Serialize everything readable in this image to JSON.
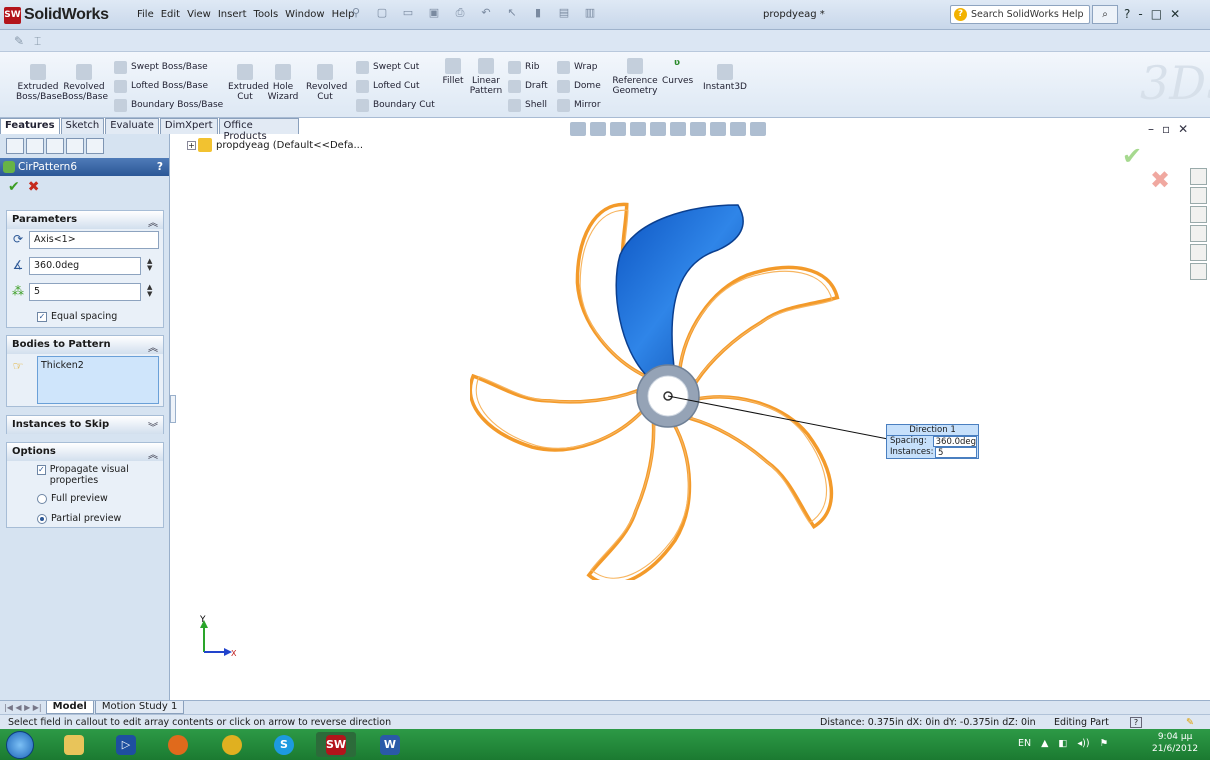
{
  "app": {
    "name": "SolidWorks",
    "document_title": "propdyeag *",
    "menu": [
      "File",
      "Edit",
      "View",
      "Insert",
      "Tools",
      "Window",
      "Help"
    ],
    "search_placeholder": "Search SolidWorks Help",
    "window_controls": [
      "?",
      "-",
      "□",
      "✕"
    ]
  },
  "command_manager": {
    "big_tools": [
      {
        "label": "Extruded Boss/Base"
      },
      {
        "label": "Revolved Boss/Base"
      },
      {
        "label": "Extruded Cut"
      },
      {
        "label": "Hole Wizard"
      },
      {
        "label": "Revolved Cut"
      },
      {
        "label": "Fillet"
      },
      {
        "label": "Linear Pattern"
      },
      {
        "label": "Reference Geometry"
      },
      {
        "label": "Curves"
      },
      {
        "label": "Instant3D"
      }
    ],
    "small_tools": {
      "swept_boss": "Swept Boss/Base",
      "lofted_boss": "Lofted Boss/Base",
      "boundary_boss": "Boundary Boss/Base",
      "swept_cut": "Swept Cut",
      "lofted_cut": "Lofted Cut",
      "boundary_cut": "Boundary Cut",
      "rib": "Rib",
      "draft": "Draft",
      "shell": "Shell",
      "wrap": "Wrap",
      "dome": "Dome",
      "mirror": "Mirror"
    }
  },
  "tabs": [
    "Features",
    "Sketch",
    "Evaluate",
    "DimXpert",
    "Office Products"
  ],
  "property_manager": {
    "title": "CirPattern6",
    "help": "?",
    "parameters": {
      "title": "Parameters",
      "axis": "Axis<1>",
      "angle": "360.0deg",
      "instances": "5",
      "equal_spacing": "Equal spacing"
    },
    "bodies": {
      "title": "Bodies to Pattern",
      "items": [
        "Thicken2"
      ]
    },
    "instances_to_skip": "Instances to Skip",
    "options": {
      "title": "Options",
      "propagate": "Propagate visual properties",
      "full_preview": "Full preview",
      "partial_preview": "Partial preview"
    }
  },
  "graphics": {
    "tree_item": "propdyeag  (Default<<Defa...",
    "callout": {
      "title": "Direction 1",
      "spacing_label": "Spacing:",
      "spacing_value": "360.0deg",
      "instances_label": "Instances:",
      "instances_value": "5"
    },
    "triad_y": "Y",
    "triad_x": "X"
  },
  "bottom_tabs": [
    "Model",
    "Motion Study 1"
  ],
  "status": {
    "message": "Select field in callout to edit array contents or click on arrow to reverse direction",
    "distance": "Distance: 0.375in  dX: 0in  dY: -0.375in  dZ: 0in",
    "mode": "Editing Part"
  },
  "taskbar": {
    "lang": "EN",
    "time": "9:04 μμ",
    "date": "21/6/2012"
  },
  "colors": {
    "blade_blue": "#1f6fd0",
    "preview_orange": "#f39a2a",
    "hub_gray": "#8e9fb3"
  }
}
